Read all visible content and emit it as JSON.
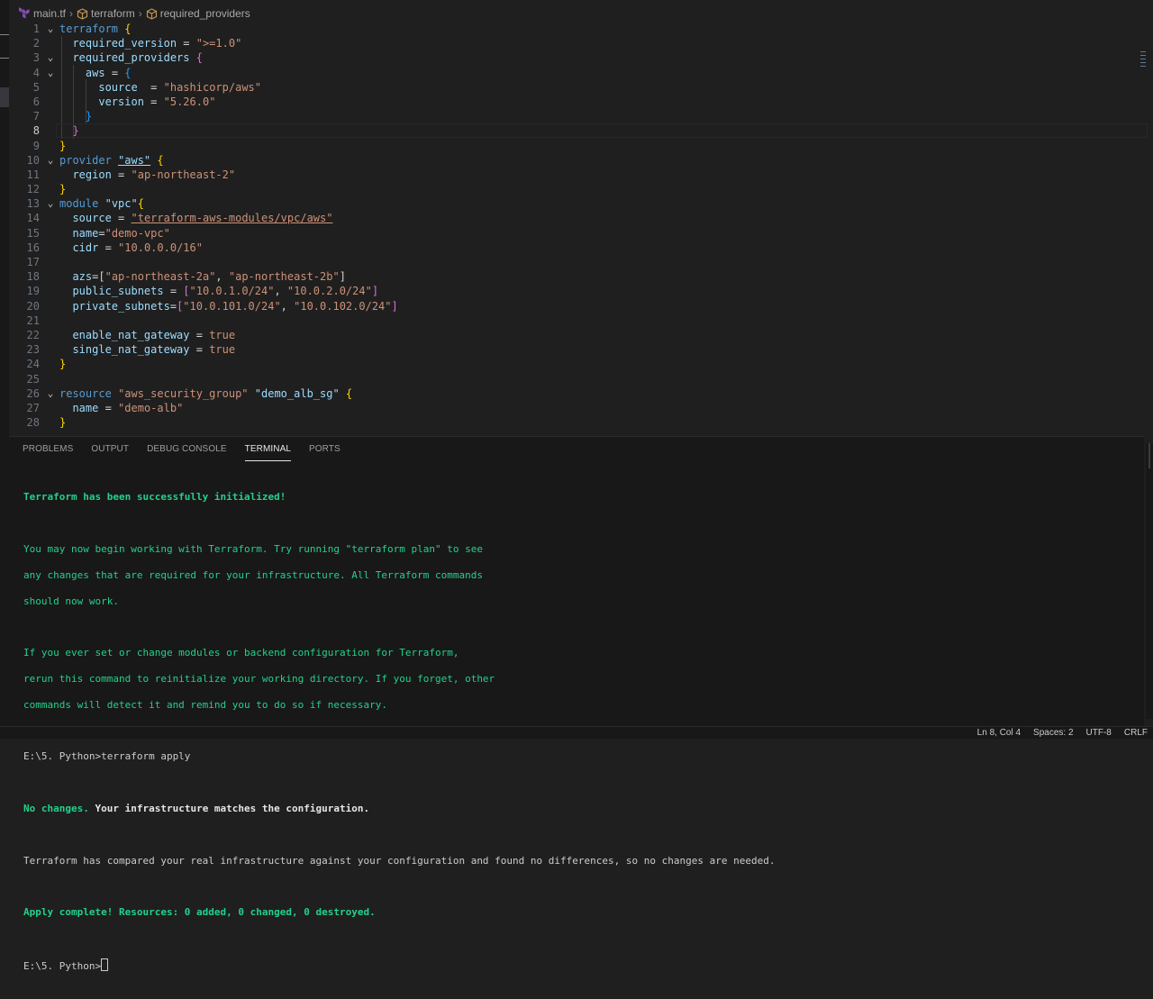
{
  "breadcrumb": {
    "file": "main.tf",
    "block": "terraform",
    "item": "required_providers"
  },
  "editor": {
    "lines": [
      {
        "n": "1",
        "active": false
      },
      {
        "n": "2",
        "active": false
      },
      {
        "n": "3",
        "active": false
      },
      {
        "n": "4",
        "active": false
      },
      {
        "n": "5",
        "active": false
      },
      {
        "n": "6",
        "active": false
      },
      {
        "n": "7",
        "active": false
      },
      {
        "n": "8",
        "active": true
      },
      {
        "n": "9",
        "active": false
      },
      {
        "n": "10",
        "active": false
      },
      {
        "n": "11",
        "active": false
      },
      {
        "n": "12",
        "active": false
      },
      {
        "n": "13",
        "active": false
      },
      {
        "n": "14",
        "active": false
      },
      {
        "n": "15",
        "active": false
      },
      {
        "n": "16",
        "active": false
      },
      {
        "n": "17",
        "active": false
      },
      {
        "n": "18",
        "active": false
      },
      {
        "n": "19",
        "active": false
      },
      {
        "n": "20",
        "active": false
      },
      {
        "n": "21",
        "active": false
      },
      {
        "n": "22",
        "active": false
      },
      {
        "n": "23",
        "active": false
      },
      {
        "n": "24",
        "active": false
      },
      {
        "n": "25",
        "active": false
      },
      {
        "n": "26",
        "active": false
      },
      {
        "n": "27",
        "active": false
      },
      {
        "n": "28",
        "active": false
      }
    ],
    "tokens": {
      "t_terraform": "terraform",
      "t_req_version": "required_version",
      "t_req_version_val": "\">=1.0\"",
      "t_req_providers": "required_providers",
      "t_aws": "aws",
      "t_source": "source",
      "t_source_val": "\"hashicorp/aws\"",
      "t_version": "version",
      "t_version_val": "\"5.26.0\"",
      "t_provider": "provider",
      "t_provider_name": "\"aws\"",
      "t_region": "region",
      "t_region_val": "\"ap-northeast-2\"",
      "t_module": "module",
      "t_module_name": "\"vpc\"",
      "t_mod_source": "source",
      "t_mod_source_val": "\"terraform-aws-modules/vpc/aws\"",
      "t_name": "name",
      "t_name_val": "\"demo-vpc\"",
      "t_cidr": "cidr",
      "t_cidr_val": "\"10.0.0.0/16\"",
      "t_azs": "azs",
      "t_az1": "\"ap-northeast-2a\"",
      "t_az2": "\"ap-northeast-2b\"",
      "t_pub": "public_subnets",
      "t_pub1": "\"10.0.1.0/24\"",
      "t_pub2": "\"10.0.2.0/24\"",
      "t_priv": "private_subnets",
      "t_priv1": "\"10.0.101.0/24\"",
      "t_priv2": "\"10.0.102.0/24\"",
      "t_enat": "enable_nat_gateway",
      "t_snat": "single_nat_gateway",
      "t_true": "true",
      "t_resource": "resource",
      "t_res_type": "\"aws_security_group\"",
      "t_res_name": "\"demo_alb_sg\"",
      "t_res_name_attr": "name",
      "t_res_name_val": "\"demo-alb\""
    }
  },
  "panel": {
    "tabs": [
      "PROBLEMS",
      "OUTPUT",
      "DEBUG CONSOLE",
      "TERMINAL",
      "PORTS"
    ],
    "active_tab": "TERMINAL"
  },
  "terminal": {
    "init_msg": "Terraform has been successfully initialized!",
    "p1_l1": "You may now begin working with Terraform. Try running \"terraform plan\" to see",
    "p1_l2": "any changes that are required for your infrastructure. All Terraform commands",
    "p1_l3": "should now work.",
    "p2_l1": "If you ever set or change modules or backend configuration for Terraform,",
    "p2_l2": "rerun this command to reinitialize your working directory. If you forget, other",
    "p2_l3": "commands will detect it and remind you to do so if necessary.",
    "cmd_line": "E:\\5. Python>terraform apply",
    "no_changes_label": "No changes.",
    "no_changes_rest": " Your infrastructure matches the configuration.",
    "compare_msg": "Terraform has compared your real infrastructure against your configuration and found no differences, so no changes are needed.",
    "apply_msg": "Apply complete! Resources: 0 added, 0 changed, 0 destroyed.",
    "prompt": "E:\\5. Python>"
  },
  "status_bar": {
    "position": "Ln 8, Col 4",
    "spaces": "Spaces: 2",
    "encoding": "UTF-8",
    "eol": "CRLF"
  }
}
